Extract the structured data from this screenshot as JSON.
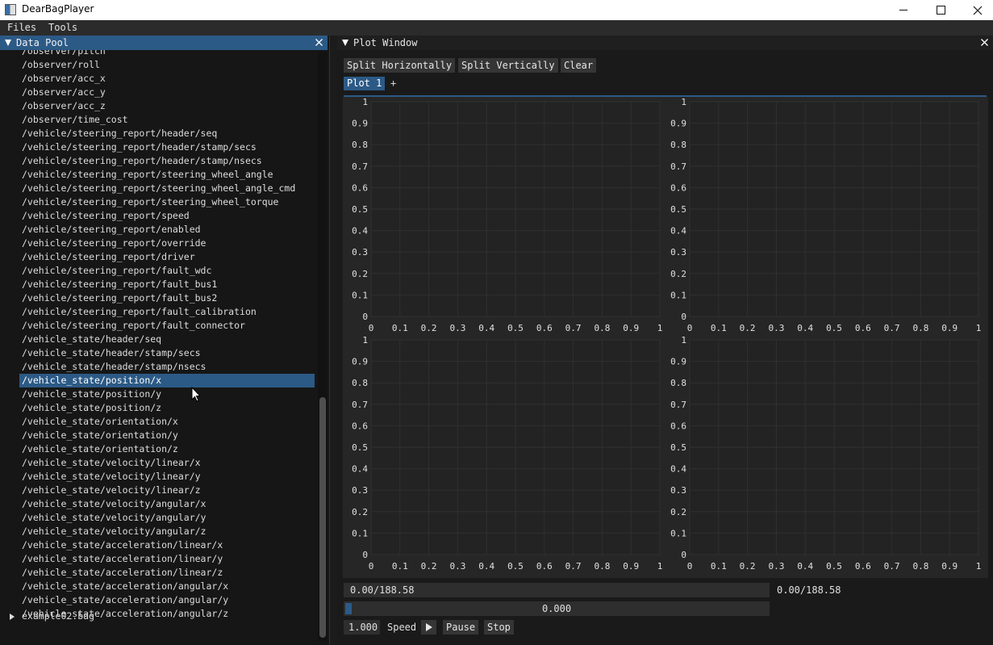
{
  "window": {
    "title": "DearBagPlayer"
  },
  "menu": {
    "files": "Files",
    "tools": "Tools"
  },
  "data_pool": {
    "title": "Data Pool",
    "items": [
      "/observer/pitch",
      "/observer/roll",
      "/observer/acc_x",
      "/observer/acc_y",
      "/observer/acc_z",
      "/observer/time_cost",
      "/vehicle/steering_report/header/seq",
      "/vehicle/steering_report/header/stamp/secs",
      "/vehicle/steering_report/header/stamp/nsecs",
      "/vehicle/steering_report/steering_wheel_angle",
      "/vehicle/steering_report/steering_wheel_angle_cmd",
      "/vehicle/steering_report/steering_wheel_torque",
      "/vehicle/steering_report/speed",
      "/vehicle/steering_report/enabled",
      "/vehicle/steering_report/override",
      "/vehicle/steering_report/driver",
      "/vehicle/steering_report/fault_wdc",
      "/vehicle/steering_report/fault_bus1",
      "/vehicle/steering_report/fault_bus2",
      "/vehicle/steering_report/fault_calibration",
      "/vehicle/steering_report/fault_connector",
      "/vehicle_state/header/seq",
      "/vehicle_state/header/stamp/secs",
      "/vehicle_state/header/stamp/nsecs",
      "/vehicle_state/position/x",
      "/vehicle_state/position/y",
      "/vehicle_state/position/z",
      "/vehicle_state/orientation/x",
      "/vehicle_state/orientation/y",
      "/vehicle_state/orientation/z",
      "/vehicle_state/velocity/linear/x",
      "/vehicle_state/velocity/linear/y",
      "/vehicle_state/velocity/linear/z",
      "/vehicle_state/velocity/angular/x",
      "/vehicle_state/velocity/angular/y",
      "/vehicle_state/velocity/angular/z",
      "/vehicle_state/acceleration/linear/x",
      "/vehicle_state/acceleration/linear/y",
      "/vehicle_state/acceleration/linear/z",
      "/vehicle_state/acceleration/angular/x",
      "/vehicle_state/acceleration/angular/y",
      "/vehicle_state/acceleration/angular/z"
    ],
    "selected_item": "/vehicle_state/position/x",
    "file": "example02.bag"
  },
  "plot_window": {
    "title": "Plot Window",
    "buttons": {
      "split_h": "Split Horizontally",
      "split_v": "Split Vertically",
      "clear": "Clear"
    },
    "tabs": [
      {
        "label": "Plot 1",
        "active": true
      }
    ],
    "add_tab": "+"
  },
  "chart_data": [
    {
      "type": "line",
      "series": [],
      "xlim": [
        0,
        1
      ],
      "ylim": [
        0,
        1
      ],
      "grid": true,
      "x_ticks": [
        "0",
        "0.1",
        "0.2",
        "0.3",
        "0.4",
        "0.5",
        "0.6",
        "0.7",
        "0.8",
        "0.9",
        "1"
      ],
      "y_ticks": [
        "0",
        "0.1",
        "0.2",
        "0.3",
        "0.4",
        "0.5",
        "0.6",
        "0.7",
        "0.8",
        "0.9",
        "1"
      ]
    },
    {
      "type": "line",
      "series": [],
      "xlim": [
        0,
        1
      ],
      "ylim": [
        0,
        1
      ],
      "grid": true,
      "x_ticks": [
        "0",
        "0.1",
        "0.2",
        "0.3",
        "0.4",
        "0.5",
        "0.6",
        "0.7",
        "0.8",
        "0.9",
        "1"
      ],
      "y_ticks": [
        "0",
        "0.1",
        "0.2",
        "0.3",
        "0.4",
        "0.5",
        "0.6",
        "0.7",
        "0.8",
        "0.9",
        "1"
      ]
    },
    {
      "type": "line",
      "series": [],
      "xlim": [
        0,
        1
      ],
      "ylim": [
        0,
        1
      ],
      "grid": true,
      "x_ticks": [
        "0",
        "0.1",
        "0.2",
        "0.3",
        "0.4",
        "0.5",
        "0.6",
        "0.7",
        "0.8",
        "0.9",
        "1"
      ],
      "y_ticks": [
        "0",
        "0.1",
        "0.2",
        "0.3",
        "0.4",
        "0.5",
        "0.6",
        "0.7",
        "0.8",
        "0.9",
        "1"
      ]
    },
    {
      "type": "line",
      "series": [],
      "xlim": [
        0,
        1
      ],
      "ylim": [
        0,
        1
      ],
      "grid": true,
      "x_ticks": [
        "0",
        "0.1",
        "0.2",
        "0.3",
        "0.4",
        "0.5",
        "0.6",
        "0.7",
        "0.8",
        "0.9",
        "1"
      ],
      "y_ticks": [
        "0",
        "0.1",
        "0.2",
        "0.3",
        "0.4",
        "0.5",
        "0.6",
        "0.7",
        "0.8",
        "0.9",
        "1"
      ]
    }
  ],
  "playback": {
    "time_value": "0.00/188.58",
    "time_label": "0.00/188.58",
    "progress_text": "0.000",
    "progress_fraction": 0.0,
    "speed_value": "1.000",
    "speed_label": "Speed",
    "pause": "Pause",
    "stop": "Stop"
  },
  "colors": {
    "accent": "#2c5a86",
    "background": "#1b1b1b",
    "panel": "#262626",
    "button": "#353535"
  }
}
